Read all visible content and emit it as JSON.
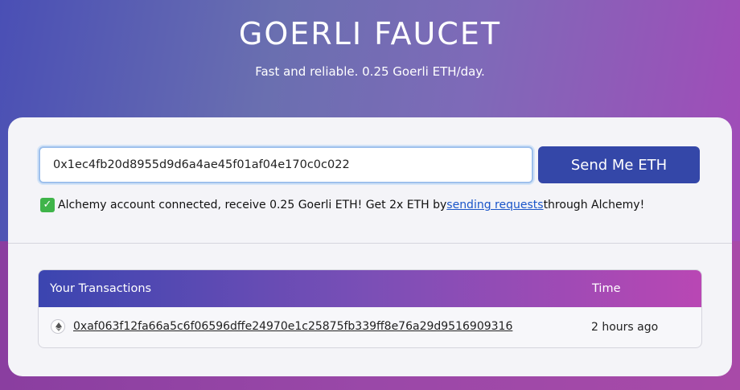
{
  "header": {
    "title": "GOERLI FAUCET",
    "subtitle": "Fast and reliable. 0.25 Goerli ETH/day."
  },
  "form": {
    "address_value": "0x1ec4fb20d8955d9d6a4ae45f01af04e170c0c022",
    "send_label": "Send Me ETH"
  },
  "notice": {
    "prefix": "Alchemy account connected, receive 0.25 Goerli ETH! Get 2x ETH by ",
    "link_text": "sending requests",
    "suffix": " through Alchemy!"
  },
  "transactions": {
    "col_tx": "Your Transactions",
    "col_time": "Time",
    "rows": [
      {
        "hash": "0xaf063f12fa66a5c6f06596dffe24970e1c25875fb339ff8e76a29d9516909316",
        "time": "2 hours ago"
      }
    ]
  },
  "colors": {
    "button": "#3447a8",
    "check": "#3fb44a",
    "link": "#1a55c9"
  }
}
